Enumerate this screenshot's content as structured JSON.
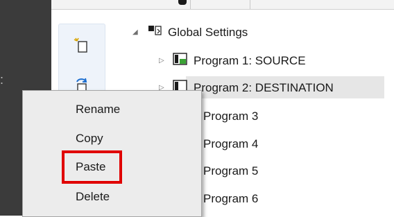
{
  "tree": {
    "root": {
      "label": "Global Settings",
      "icon": "global-settings-icon",
      "expander": "collapse-arrow"
    },
    "programs": [
      {
        "label": "Program 1: SOURCE",
        "icon": "program-icon-green"
      },
      {
        "label": "Program 2: DESTINATION",
        "icon": "program-icon-outline"
      },
      {
        "label": "Program 3"
      },
      {
        "label": "Program 4"
      },
      {
        "label": "Program 5"
      },
      {
        "label": "Program 6"
      }
    ]
  },
  "toolbar": {
    "new_icon": "new-item-icon",
    "copy_icon": "copy-item-icon"
  },
  "context_menu": {
    "items": [
      "Rename",
      "Copy",
      "Paste",
      "Delete"
    ],
    "highlight_color": "#e00000"
  }
}
